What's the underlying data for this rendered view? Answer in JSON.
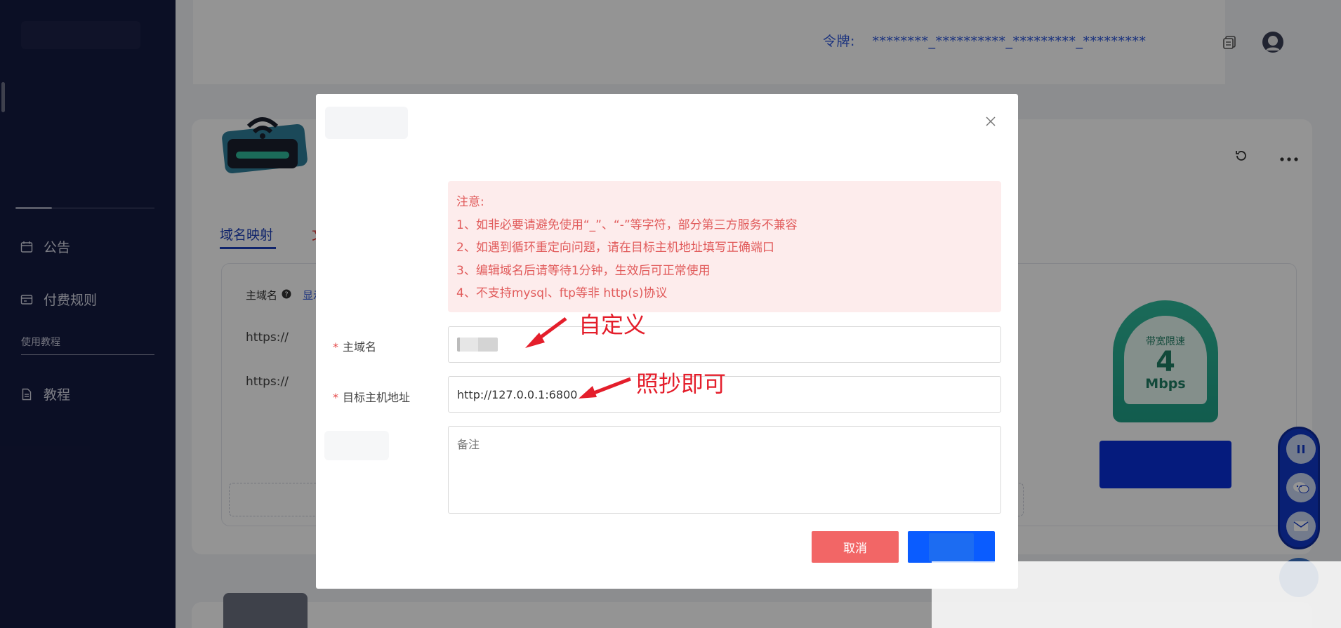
{
  "sidebar": {
    "items": [
      {
        "label": "公告",
        "icon": "calendar-icon"
      },
      {
        "label": "付费规则",
        "icon": "wallet-icon"
      },
      {
        "label": "教程",
        "icon": "document-icon"
      }
    ],
    "section": "使用教程"
  },
  "header": {
    "token_label": "令牌:",
    "token_value": "********_**********_*********_*********"
  },
  "main": {
    "tabs": [
      {
        "label": "域名映射"
      },
      {
        "label": "文"
      }
    ],
    "column_label": "主域名",
    "show_link": "显示",
    "rows": [
      "https://",
      "https://"
    ],
    "speed": {
      "label": "带宽限速",
      "value": "4",
      "unit": "Mbps"
    }
  },
  "modal": {
    "notice": {
      "title": "注意:",
      "lines": [
        "1、如非必要请避免使用“_”、“-”等字符，部分第三方服务不兼容",
        "2、如遇到循环重定向问题，请在目标主机地址填写正确端口",
        "3、编辑域名后请等待1分钟，生效后可正常使用",
        "4、不支持mysql、ftp等非 http(s)协议"
      ]
    },
    "fields": {
      "domain_label": "主域名",
      "target_label": "目标主机地址",
      "target_value": "http://127.0.0.1:6800",
      "remark_placeholder": "备注"
    },
    "buttons": {
      "cancel": "取消"
    },
    "annotations": {
      "custom": "自定义",
      "copy": "照抄即可"
    }
  },
  "colors": {
    "sidebar_bg": "#141a40",
    "accent": "#0a5cff",
    "danger": "#f26666",
    "notice_bg": "#fdecec",
    "annotation": "#e41e2b"
  }
}
